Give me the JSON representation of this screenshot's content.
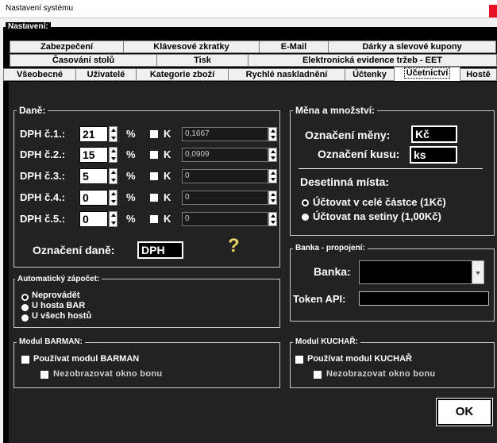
{
  "window": {
    "title": "Nastavení systému"
  },
  "group_label": "Nastavení:",
  "tabs": {
    "row1": [
      "Zabezpečení",
      "Klávesové zkratky",
      "E-Mail",
      "Dárky a slevové kupony"
    ],
    "row2": [
      "Časování stolů",
      "Tisk",
      "Elektronická evidence tržeb - EET"
    ],
    "row3": [
      "Všeobecné",
      "Uživatelé",
      "Kategorie zboží",
      "Rychlé naskladnění",
      "Účtenky",
      "Účetnictví",
      "Hostě"
    ],
    "active": "Účetnictví"
  },
  "dane": {
    "legend": "Daně:",
    "percent_symbol": "%",
    "k_label": "K",
    "rows": [
      {
        "label": "DPH č.1.:",
        "value": "21",
        "k": "0,1667"
      },
      {
        "label": "DPH č.2.:",
        "value": "15",
        "k": "0,0909"
      },
      {
        "label": "DPH č.3.:",
        "value": "5",
        "k": "0"
      },
      {
        "label": "DPH č.4.:",
        "value": "0",
        "k": "0"
      },
      {
        "label": "DPH č.5.:",
        "value": "0",
        "k": "0"
      }
    ],
    "oznaceni_label": "Označení daně:",
    "oznaceni_value": "DPH",
    "help_icon": "?"
  },
  "mena": {
    "legend": "Měna a množství:",
    "currency_label": "Označení měny:",
    "currency_value": "Kč",
    "unit_label": "Označení kusu:",
    "unit_value": "ks",
    "decimals_label": "Desetinná místa:",
    "options": [
      "Účtovat v celé částce (1Kč)",
      "Účtovat na setiny (1,00Kč)"
    ]
  },
  "banka": {
    "legend": "Banka - propojení:",
    "bank_label": "Banka:",
    "bank_value": "",
    "token_label": "Token API:",
    "token_value": ""
  },
  "zapocet": {
    "legend": "Automatický zápočet:",
    "options": [
      "Neprovádět",
      "U hosta BAR",
      "U všech hostů"
    ]
  },
  "barman": {
    "legend": "Modul BARMAN:",
    "use_label": "Používat modul BARMAN",
    "hide_label": "Nezobrazovat okno bonu"
  },
  "kuchar": {
    "legend": "Modul KUCHAŘ:",
    "use_label": "Používat modul KUCHAŘ",
    "hide_label": "Nezobrazovat okno bonu"
  },
  "ok_label": "OK",
  "colors": {
    "panel": "#222222",
    "background": "#000000",
    "accent_close": "#e81123"
  }
}
